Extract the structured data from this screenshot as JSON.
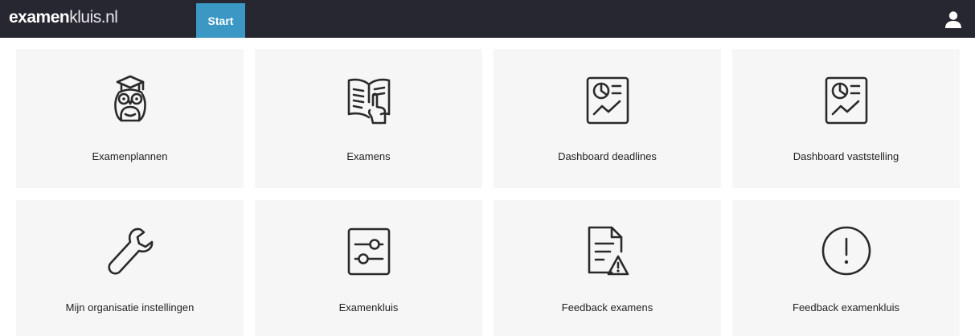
{
  "brand": {
    "bold": "examen",
    "light": "kluis.nl"
  },
  "nav": {
    "start_label": "Start"
  },
  "colors": {
    "topbar": "#262730",
    "accent": "#3b97c4",
    "tile_bg": "#f6f6f6"
  },
  "tiles": [
    {
      "label": "Examenplannen",
      "icon": "owl-graduation-icon"
    },
    {
      "label": "Examens",
      "icon": "open-book-hand-icon"
    },
    {
      "label": "Dashboard deadlines",
      "icon": "dashboard-chart-icon"
    },
    {
      "label": "Dashboard vaststelling",
      "icon": "dashboard-chart-icon"
    },
    {
      "label": "Mijn organisatie instellingen",
      "icon": "wrench-icon"
    },
    {
      "label": "Examenkluis",
      "icon": "sliders-icon"
    },
    {
      "label": "Feedback examens",
      "icon": "document-warning-icon"
    },
    {
      "label": "Feedback examenkluis",
      "icon": "exclamation-circle-icon"
    }
  ]
}
